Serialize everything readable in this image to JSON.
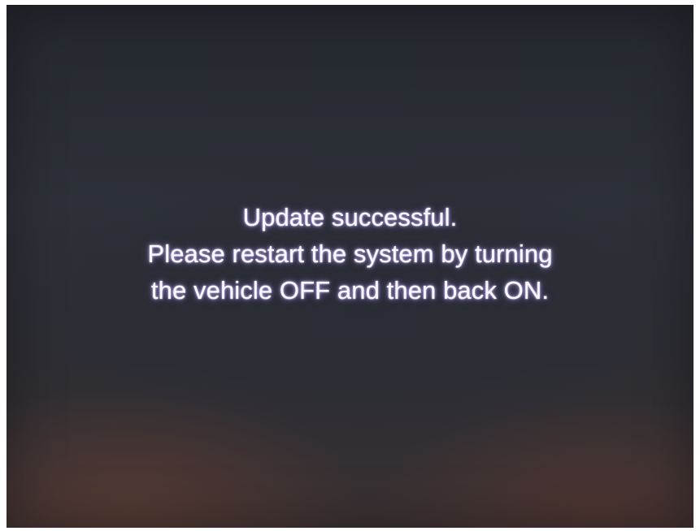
{
  "dialog": {
    "line1": "Update successful.",
    "line2": "Please restart the system by turning",
    "line3": "the vehicle OFF and then back ON."
  },
  "colors": {
    "screen_background": "#2d3038",
    "text": "#f8f6ff",
    "text_glow": "#b9a7ff"
  }
}
